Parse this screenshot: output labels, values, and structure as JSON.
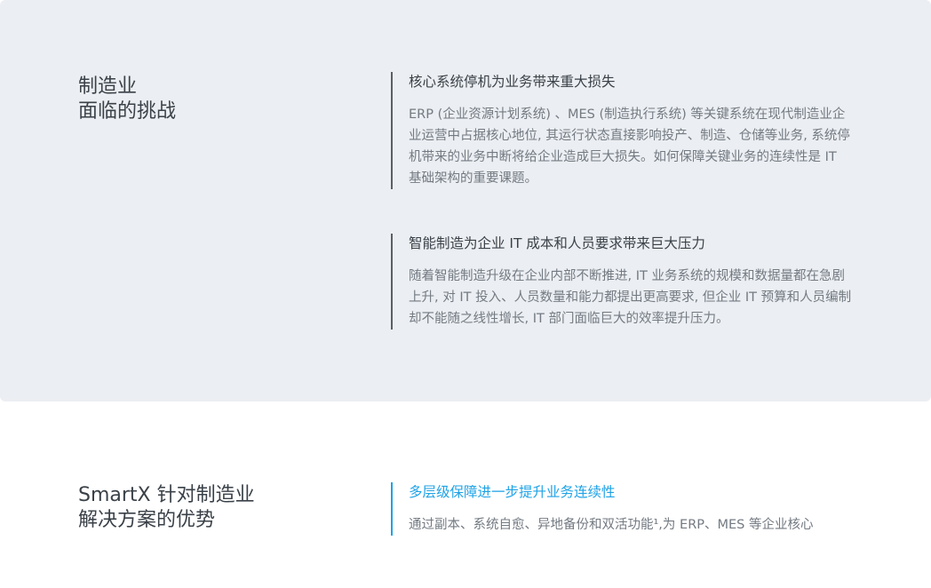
{
  "challenges": {
    "title_line1": "制造业",
    "title_line2": "面临的挑战",
    "items": [
      {
        "heading": "核心系统停机为业务带来重大损失",
        "body": "ERP (企业资源计划系统) 、MES (制造执行系统) 等关键系统在现代制造业企业运营中占据核心地位, 其运行状态直接影响投产、制造、仓储等业务, 系统停机带来的业务中断将给企业造成巨大损失。如何保障关键业务的连续性是 IT 基础架构的重要课题。"
      },
      {
        "heading": "智能制造为企业 IT 成本和人员要求带来巨大压力",
        "body": "随着智能制造升级在企业内部不断推进, IT 业务系统的规模和数据量都在急剧上升, 对 IT 投入、人员数量和能力都提出更高要求, 但企业 IT 预算和人员编制却不能随之线性增长, IT 部门面临巨大的效率提升压力。"
      }
    ]
  },
  "advantages": {
    "title_line1": "SmartX 针对制造业",
    "title_line2": "解决方案的优势",
    "items": [
      {
        "heading": "多层级保障进一步提升业务连续性",
        "body": "通过副本、系统自愈、异地备份和双活功能¹,为 ERP、MES 等企业核心"
      }
    ]
  },
  "colors": {
    "top_background": "#ebeef2",
    "accent": "#1ea2e6",
    "heading_text": "#3a4148",
    "body_text": "#737a82"
  }
}
